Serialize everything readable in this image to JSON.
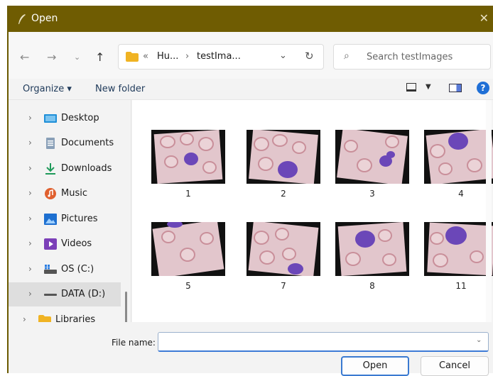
{
  "window": {
    "title": "Open",
    "close_glyph": "✕",
    "colors": {
      "titlebar": "#6f5c02",
      "accent": "#3a7ad1"
    }
  },
  "nav": {
    "back_icon": "arrow-left",
    "forward_icon": "arrow-right",
    "recent_icon": "chevron-down",
    "up_icon": "arrow-up",
    "breadcrumb": [
      "«",
      "Hu...",
      "›",
      "testIma..."
    ],
    "refresh_icon": "refresh",
    "search_placeholder": "Search testImages"
  },
  "toolbar": {
    "organize_label": "Organize ▾",
    "new_folder_label": "New folder",
    "help_label": "?"
  },
  "sidebar": {
    "items": [
      {
        "label": "Desktop",
        "icon": "desktop-icon"
      },
      {
        "label": "Documents",
        "icon": "documents-icon"
      },
      {
        "label": "Downloads",
        "icon": "downloads-icon"
      },
      {
        "label": "Music",
        "icon": "music-icon"
      },
      {
        "label": "Pictures",
        "icon": "pictures-icon"
      },
      {
        "label": "Videos",
        "icon": "videos-icon"
      },
      {
        "label": "OS (C:)",
        "icon": "drive-icon"
      },
      {
        "label": "DATA (D:)",
        "icon": "drive-icon",
        "selected": true
      },
      {
        "label": "Libraries",
        "icon": "folder-icon"
      }
    ]
  },
  "files": [
    {
      "name": "1"
    },
    {
      "name": "2"
    },
    {
      "name": "3"
    },
    {
      "name": "4"
    },
    {
      "name": "5"
    },
    {
      "name": "7"
    },
    {
      "name": "8"
    },
    {
      "name": "11"
    }
  ],
  "footer": {
    "file_name_label": "File name:",
    "file_name_value": "",
    "open_label": "Open",
    "cancel_label": "Cancel"
  }
}
